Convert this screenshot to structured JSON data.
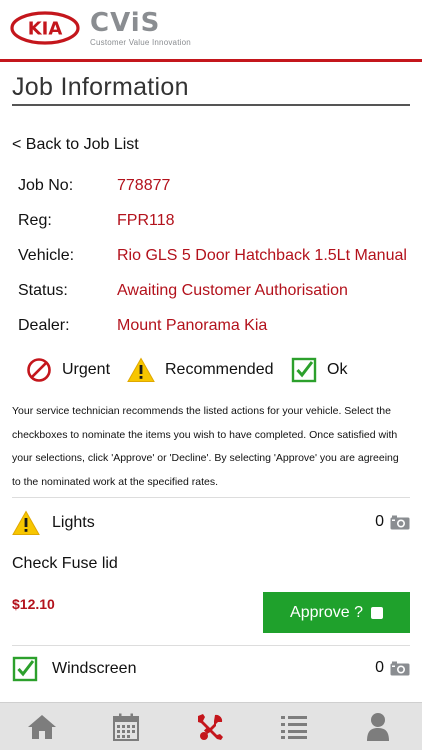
{
  "brand": {
    "kia_text": "KIA",
    "cvis_text": "CViS",
    "cvis_tagline": "Customer Value Innovation",
    "accent_color": "#c4161c"
  },
  "page": {
    "title": "Job Information",
    "back_label": "< Back to Job List"
  },
  "job": {
    "job_no_label": "Job No:",
    "job_no": "778877",
    "reg_label": "Reg:",
    "reg": "FPR118",
    "vehicle_label": "Vehicle:",
    "vehicle": "Rio GLS 5 Door Hatchback 1.5Lt Manual",
    "status_label": "Status:",
    "status": "Awaiting Customer Authorisation",
    "dealer_label": "Dealer:",
    "dealer": "Mount Panorama Kia"
  },
  "legend": {
    "urgent": "Urgent",
    "recommended": "Recommended",
    "ok": "Ok"
  },
  "instructions": "Your service technician recommends the listed actions for your vehicle. Select the checkboxes to nominate the items you wish to have completed. Once satisfied with your selections, click 'Approve' or 'Decline'. By selecting 'Approve' you are agreeing to the nominated work at the specified rates.",
  "items": [
    {
      "name": "Lights",
      "status_icon": "warning-icon",
      "photo_count": "0",
      "description": "Check Fuse lid",
      "price": "$12.10",
      "approve_label": "Approve ?"
    },
    {
      "name": "Windscreen",
      "status_icon": "check-icon",
      "photo_count": "0"
    }
  ],
  "tabbar": {
    "tabs": [
      "home-icon",
      "calendar-icon",
      "service-tools-icon",
      "list-icon",
      "profile-icon"
    ],
    "active_tab": "service-tools-icon",
    "active_color": "#c4161c",
    "inactive_color": "#7d7d7d"
  }
}
